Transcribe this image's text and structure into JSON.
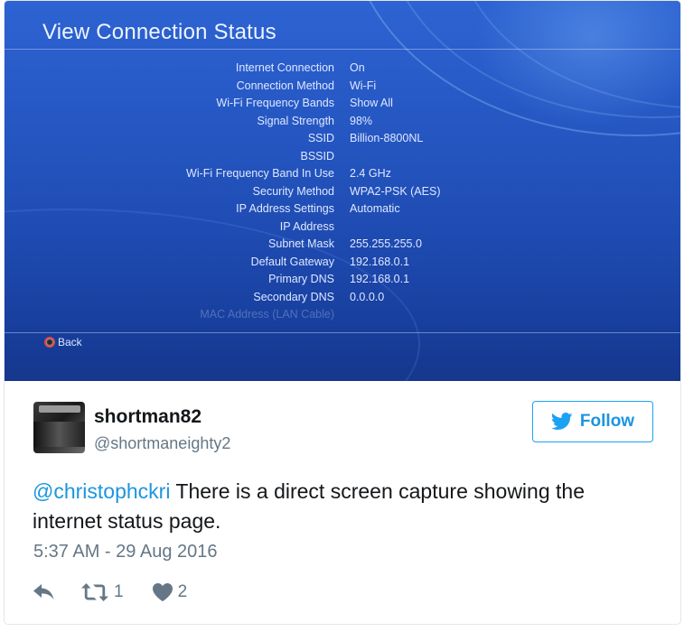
{
  "ps4_screen": {
    "title": "View Connection Status",
    "rows": [
      {
        "label": "Internet Connection",
        "value": "On"
      },
      {
        "label": "Connection Method",
        "value": "Wi-Fi"
      },
      {
        "label": "Wi-Fi Frequency Bands",
        "value": "Show All"
      },
      {
        "label": "Signal Strength",
        "value": "98%"
      },
      {
        "label": "SSID",
        "value": "Billion-8800NL"
      },
      {
        "label": "BSSID",
        "value": ""
      },
      {
        "label": "Wi-Fi Frequency Band In Use",
        "value": "2.4 GHz"
      },
      {
        "label": "Security Method",
        "value": "WPA2-PSK (AES)"
      },
      {
        "label": "IP Address Settings",
        "value": "Automatic"
      },
      {
        "label": "IP Address",
        "value": ""
      },
      {
        "label": "Subnet Mask",
        "value": "255.255.255.0"
      },
      {
        "label": "Default Gateway",
        "value": "192.168.0.1"
      },
      {
        "label": "Primary DNS",
        "value": "192.168.0.1"
      },
      {
        "label": "Secondary DNS",
        "value": "0.0.0.0"
      },
      {
        "label": "MAC Address (LAN Cable)",
        "value": ""
      }
    ],
    "back_label": "Back"
  },
  "tweet": {
    "display_name": "shortman82",
    "handle": "@shortmaneighty2",
    "follow_label": "Follow",
    "mention": "@christophckri",
    "text": " There is a direct screen capture showing the internet status page.",
    "timestamp": "5:37 AM - 29 Aug 2016",
    "retweet_count": "1",
    "like_count": "2"
  },
  "colors": {
    "ps4_blue": "#2658c4",
    "twitter_blue": "#1da1f2",
    "link_blue": "#1b95e0",
    "muted_gray": "#657786",
    "like_icon": "#657786"
  },
  "icons": [
    "circle-button-icon",
    "twitter-bird-icon",
    "reply-icon",
    "retweet-icon",
    "heart-icon"
  ]
}
